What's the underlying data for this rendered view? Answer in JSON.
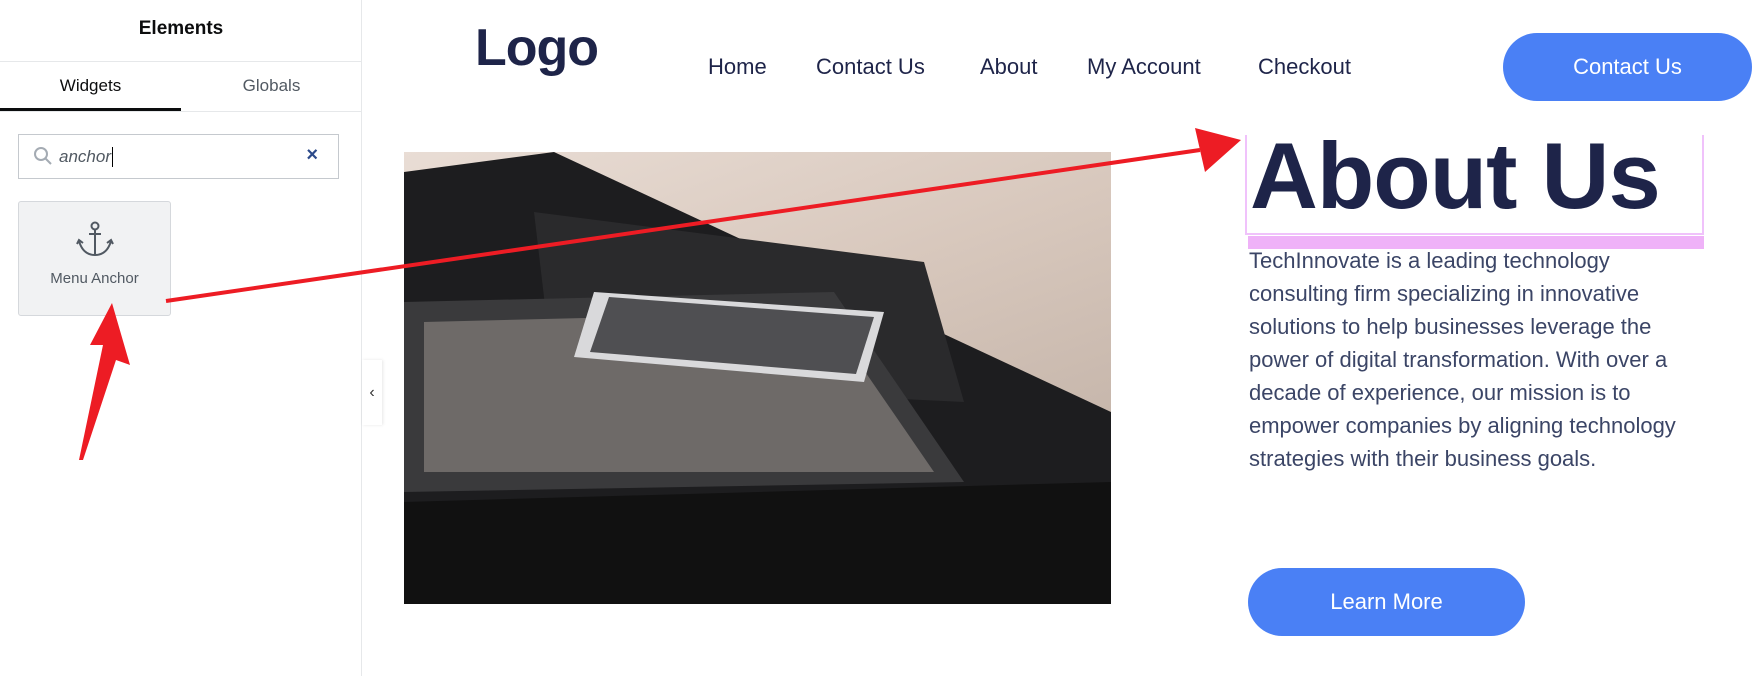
{
  "sidebar": {
    "title": "Elements",
    "tabs": [
      {
        "label": "Widgets",
        "active": true
      },
      {
        "label": "Globals",
        "active": false
      }
    ],
    "search": {
      "value": "anchor",
      "clear_icon": "×"
    },
    "widgets": [
      {
        "label": "Menu Anchor",
        "icon": "anchor-icon"
      }
    ],
    "collapse_icon": "‹"
  },
  "header": {
    "logo": "Logo",
    "nav": [
      "Home",
      "Contact Us",
      "About",
      "My Account",
      "Checkout"
    ],
    "cta": "Contact Us"
  },
  "main": {
    "heading": "About Us",
    "paragraph": "TechInnovate is a leading technology consulting firm specializing in innovative solutions to help businesses leverage the power of digital transformation. With over a decade of experience, our mission is to empower companies by aligning technology strategies with their business goals.",
    "button": "Learn More"
  },
  "colors": {
    "accent": "#4a80f5",
    "heading": "#1e2449",
    "annotation": "#ed1c24",
    "selection": "#efb2f8"
  }
}
